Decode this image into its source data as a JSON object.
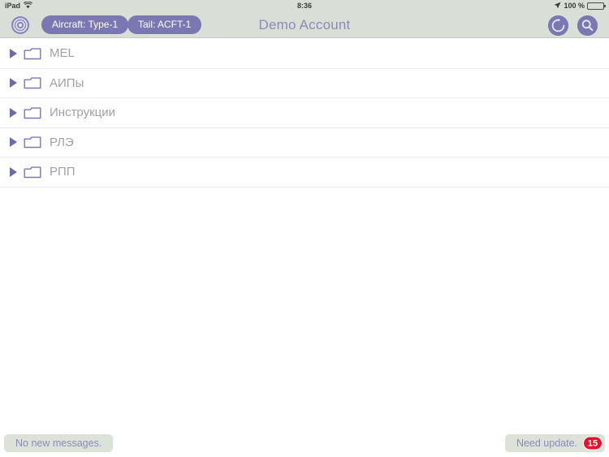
{
  "status_bar": {
    "device": "iPad",
    "wifi_icon": "wifi-icon",
    "time": "8:36",
    "location_icon": "location-arrow-icon",
    "battery_percent": "100 %",
    "battery_icon": "battery-full-icon"
  },
  "nav_bar": {
    "target_icon": "target-icon",
    "aircraft_pill": "Aircraft: Type-1",
    "tail_pill": "Tail: ACFT-1",
    "title": "Demo Account",
    "refresh_icon": "refresh-icon",
    "search_icon": "search-icon",
    "background_color": "#d9dfd6",
    "accent_color": "#7a77b3"
  },
  "list": {
    "rows": [
      {
        "label": "MEL",
        "disclosure_icon": "triangle-right-icon",
        "folder_icon": "folder-icon"
      },
      {
        "label": "АИПы",
        "disclosure_icon": "triangle-right-icon",
        "folder_icon": "folder-icon"
      },
      {
        "label": "Инструкции",
        "disclosure_icon": "triangle-right-icon",
        "folder_icon": "folder-icon"
      },
      {
        "label": "РЛЭ",
        "disclosure_icon": "triangle-right-icon",
        "folder_icon": "folder-icon"
      },
      {
        "label": "РПП",
        "disclosure_icon": "triangle-right-icon",
        "folder_icon": "folder-icon"
      }
    ]
  },
  "footer": {
    "messages_label": "No new messages.",
    "update_label": "Need update.",
    "update_badge": "15",
    "badge_color": "#e8112d"
  }
}
